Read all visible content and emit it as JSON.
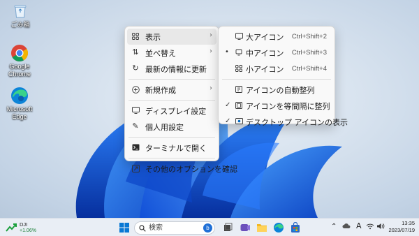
{
  "desktop_icons": [
    {
      "label": "ごみ箱",
      "icon": "recycle-bin-icon"
    },
    {
      "label": "Google Chrome",
      "icon": "chrome-icon"
    },
    {
      "label": "Microsoft Edge",
      "icon": "edge-icon"
    }
  ],
  "context_menu": {
    "items": [
      {
        "label": "表示",
        "icon": "view-grid-icon",
        "submenu": true
      },
      {
        "label": "並べ替え",
        "icon": "sort-icon",
        "submenu": true
      },
      {
        "label": "最新の情報に更新",
        "icon": "refresh-icon"
      },
      {
        "label": "新規作成",
        "icon": "new-plus-icon",
        "submenu": true
      },
      {
        "label": "ディスプレイ設定",
        "icon": "display-icon"
      },
      {
        "label": "個人用設定",
        "icon": "pen-icon"
      },
      {
        "label": "ターミナルで開く",
        "icon": "terminal-icon"
      },
      {
        "label": "その他のオプションを確認",
        "icon": "more-options-icon"
      }
    ]
  },
  "view_submenu": {
    "items": [
      {
        "label": "大アイコン",
        "shortcut": "Ctrl+Shift+2",
        "icon": "large-icon-icon"
      },
      {
        "label": "中アイコン",
        "shortcut": "Ctrl+Shift+3",
        "icon": "medium-icon-icon",
        "selected": true
      },
      {
        "label": "小アイコン",
        "shortcut": "Ctrl+Shift+4",
        "icon": "small-icon-icon"
      },
      {
        "label": "アイコンの自動整列",
        "icon": "auto-arrange-icon"
      },
      {
        "label": "アイコンを等間隔に整列",
        "icon": "align-grid-icon",
        "checked": true
      },
      {
        "label": "デスクトップ アイコンの表示",
        "icon": "show-desktop-icons-icon",
        "checked": true
      }
    ]
  },
  "taskbar": {
    "weather_name": "DJI",
    "weather_value": "+1.06%",
    "search_placeholder": "検索",
    "time": "13:35",
    "date": "2023/07/19",
    "ime": "A"
  },
  "colors": {
    "accent": "#0067c0",
    "taskbar": "#e9eef5",
    "menu_bg": "#f9f9f9"
  }
}
